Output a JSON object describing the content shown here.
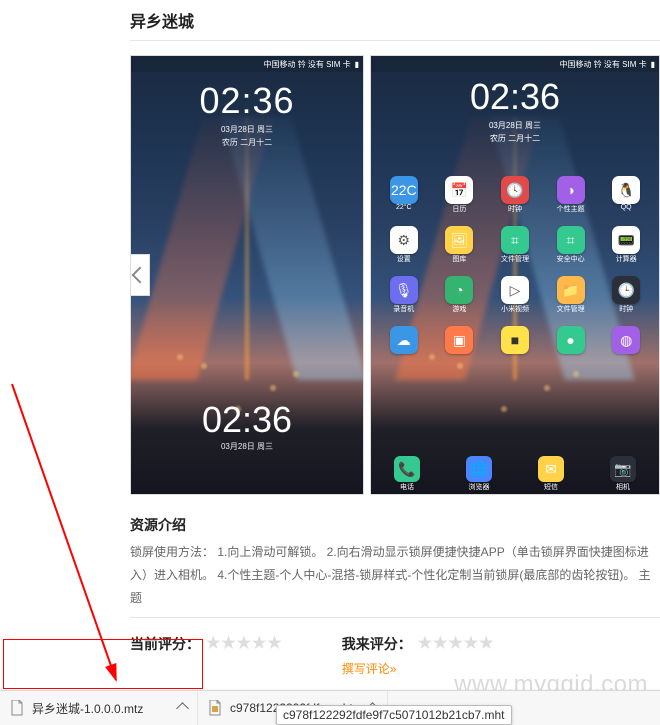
{
  "title": "异乡迷城",
  "screenshots": {
    "statusbar": "中国移动 钤 没有 SIM 卡",
    "clock": {
      "time": "02:36",
      "date": "03月28日 周三",
      "lunar": "农历 二月十二"
    },
    "apps_row1": [
      {
        "label": "22°C",
        "color": "#3b97e6",
        "glyph": "22C"
      },
      {
        "label": "日历",
        "color": "#fff",
        "glyph": "📅",
        "fg": "#333"
      },
      {
        "label": "时钟",
        "color": "#e24a4a",
        "glyph": "🕓"
      },
      {
        "label": "个性主题",
        "color": "#a260e6",
        "glyph": "◑"
      },
      {
        "label": "QQ",
        "color": "#fff",
        "glyph": "🐧",
        "fg": "#222"
      }
    ],
    "apps_row2": [
      {
        "label": "设置",
        "color": "#fff",
        "glyph": "⚙",
        "fg": "#555"
      },
      {
        "label": "图库",
        "color": "#ffd24a",
        "glyph": "🖼"
      },
      {
        "label": "文件管理",
        "color": "#34c98f",
        "glyph": "⌗"
      },
      {
        "label": "安全中心",
        "color": "#34c98f",
        "glyph": "⌗"
      },
      {
        "label": "计算器",
        "color": "#fff",
        "glyph": "📟",
        "fg": "#555"
      }
    ],
    "apps_row3": [
      {
        "label": "录音机",
        "color": "#6d6df0",
        "glyph": "🎙"
      },
      {
        "label": "游戏",
        "color": "#34b371",
        "glyph": "◔"
      },
      {
        "label": "小米视频",
        "color": "#fff",
        "glyph": "▷",
        "fg": "#555"
      },
      {
        "label": "文件管理",
        "color": "#ffb84a",
        "glyph": "📁"
      },
      {
        "label": "时钟",
        "color": "#2b2f3a",
        "glyph": "🕒"
      }
    ],
    "apps_row4": [
      {
        "label": "",
        "color": "#3b97e6",
        "glyph": "☁"
      },
      {
        "label": "",
        "color": "#ff7a4a",
        "glyph": "▣"
      },
      {
        "label": "",
        "color": "#ffe14a",
        "glyph": "■",
        "fg": "#333"
      },
      {
        "label": "",
        "color": "#34c98f",
        "glyph": "●"
      },
      {
        "label": "",
        "color": "#a260e6",
        "glyph": "◍"
      }
    ],
    "dock": [
      {
        "label": "电话",
        "color": "#34c98f",
        "glyph": "📞"
      },
      {
        "label": "浏览器",
        "color": "#4a86ff",
        "glyph": "🌐"
      },
      {
        "label": "短信",
        "color": "#ffd24a",
        "glyph": "✉"
      },
      {
        "label": "相机",
        "color": "#2b2f3a",
        "glyph": "📷"
      }
    ]
  },
  "resource_intro_title": "资源介绍",
  "resource_intro_text": "锁屏使用方法：  1.向上滑动可解锁。 2.向右滑动显示锁屏便捷快捷APP（单击锁屏界面快捷图标进入）进入相机。 4.个性主题-个人中心-混搭-锁屏样式-个性化定制当前锁屏(最底部的齿轮按钮)。 主题",
  "rating": {
    "current_label": "当前评分：",
    "mine_label": "我来评分：",
    "write_review": "撰写评论»"
  },
  "downloads": {
    "file1": "异乡迷城-1.0.0.0.mtz",
    "file2_display": "c978f1222292fdf....mht",
    "file2_tooltip": "c978f122292fdfe9f7c5071012b21cb7.mht"
  },
  "watermark": "www.myqqjd.com"
}
